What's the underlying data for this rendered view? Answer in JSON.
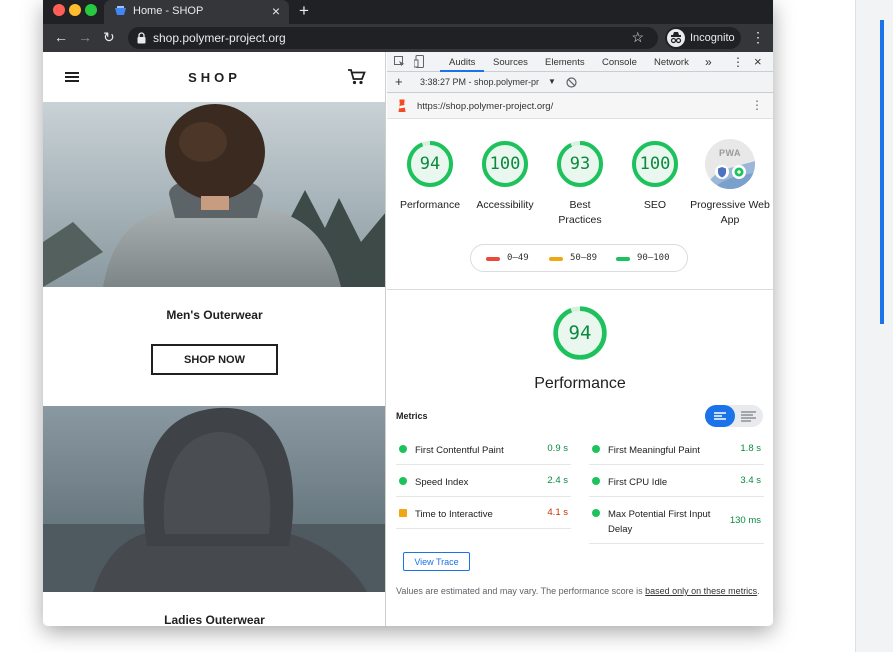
{
  "browser": {
    "tab_title": "Home - SHOP",
    "url": "shop.polymer-project.org",
    "incognito_label": "Incognito"
  },
  "shop": {
    "title": "SHOP",
    "categories": [
      {
        "title": "Men's Outerwear",
        "button": "SHOP NOW"
      },
      {
        "title": "Ladies Outerwear"
      }
    ]
  },
  "devtools": {
    "tabs": [
      "Audits",
      "Sources",
      "Elements",
      "Console",
      "Network"
    ],
    "more": "»",
    "report_label": "3:38:27 PM - shop.polymer-pr",
    "audited_url": "https://shop.polymer-project.org/",
    "scores": [
      {
        "label": "Performance",
        "value": 94
      },
      {
        "label": "Accessibility",
        "value": 100
      },
      {
        "label": "Best Practices",
        "value": 93
      },
      {
        "label": "SEO",
        "value": 100
      }
    ],
    "pwa": {
      "label": "Progressive Web App",
      "badge": "PWA"
    },
    "legend": [
      {
        "range": "0–49",
        "color": "#eb4a3b"
      },
      {
        "range": "50–89",
        "color": "#f0a713"
      },
      {
        "range": "90–100",
        "color": "#1ec25d"
      }
    ],
    "performance": {
      "score": 94,
      "title": "Performance",
      "metrics_label": "Metrics",
      "metrics": [
        {
          "label": "First Contentful Paint",
          "value": "0.9 s",
          "status": "pass"
        },
        {
          "label": "First Meaningful Paint",
          "value": "1.8 s",
          "status": "pass"
        },
        {
          "label": "Speed Index",
          "value": "2.4 s",
          "status": "pass"
        },
        {
          "label": "First CPU Idle",
          "value": "3.4 s",
          "status": "pass"
        },
        {
          "label": "Time to Interactive",
          "value": "4.1 s",
          "status": "average"
        },
        {
          "label": "Max Potential First Input Delay",
          "value": "130 ms",
          "status": "pass"
        }
      ],
      "view_trace": "View Trace",
      "note_prefix": "Values are estimated and may vary. The performance score is ",
      "note_link": "based only on these metrics",
      "note_suffix": "."
    },
    "colors": {
      "pass": "#0a8a3e",
      "average": "#c33300",
      "pass_dot": "#1ec25d",
      "average_dot": "#f0a713",
      "accent": "#1a73e8"
    }
  }
}
